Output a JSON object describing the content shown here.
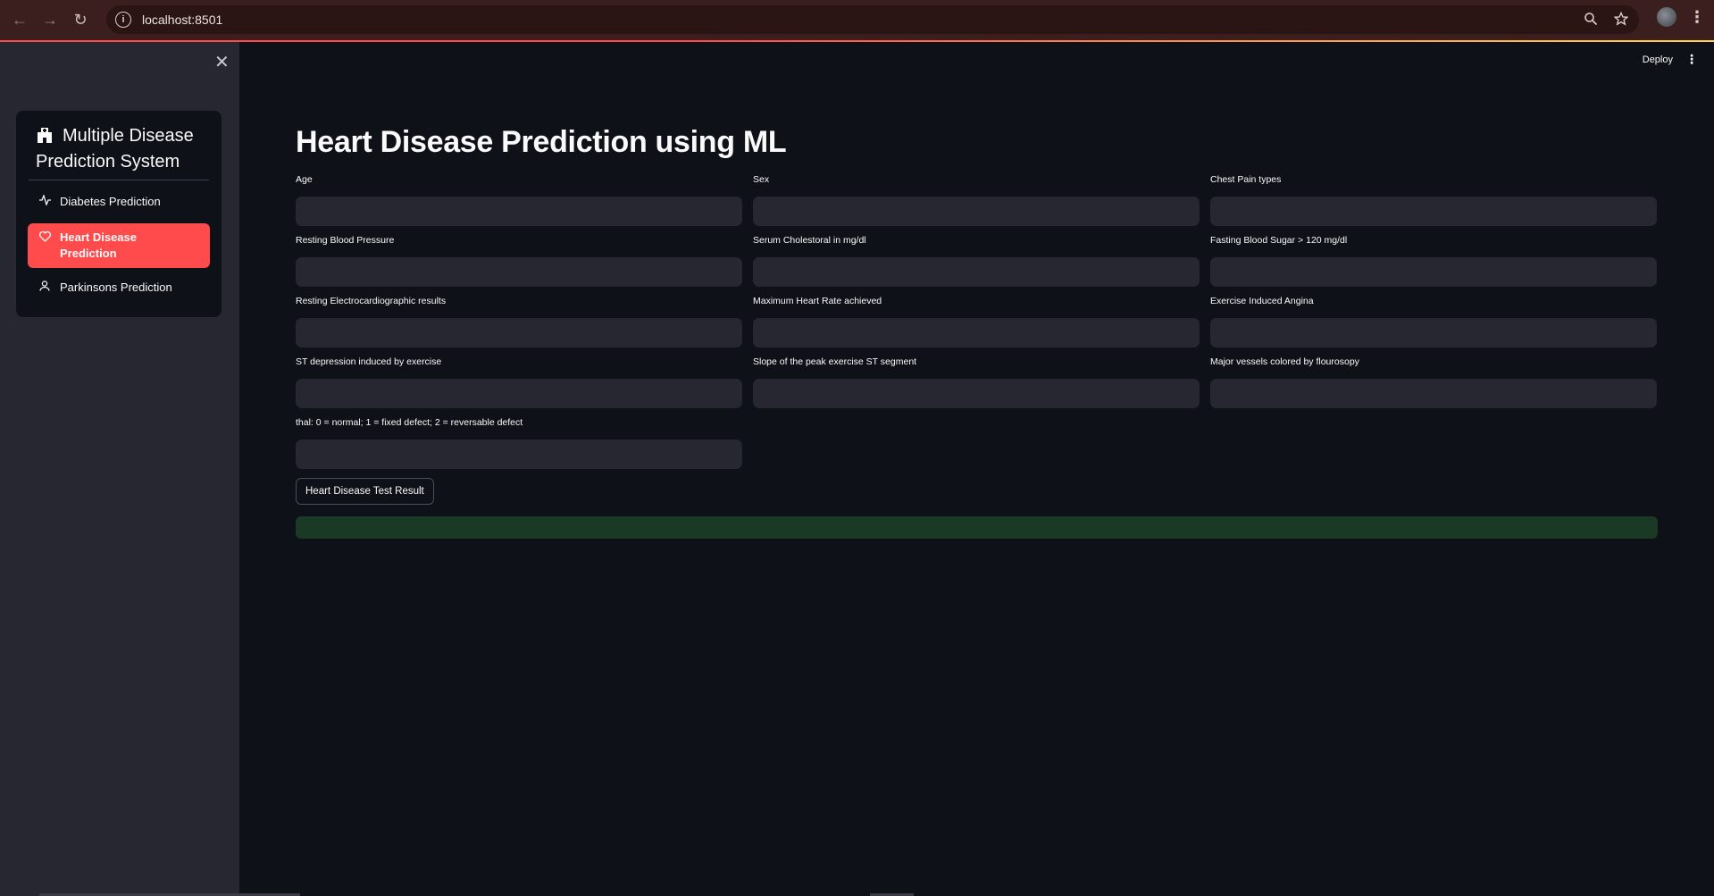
{
  "browser": {
    "url": "localhost:8501"
  },
  "app": {
    "deploy_label": "Deploy",
    "sidebar": {
      "menu_title": "Multiple Disease Prediction System",
      "items": [
        {
          "label": "Diabetes Prediction",
          "icon": "activity-icon",
          "selected": false
        },
        {
          "label": "Heart Disease Prediction",
          "icon": "heart-icon",
          "selected": true
        },
        {
          "label": "Parkinsons Prediction",
          "icon": "person-icon",
          "selected": false
        }
      ]
    },
    "main": {
      "title": "Heart Disease Prediction using ML",
      "fields": [
        {
          "label": "Age",
          "value": ""
        },
        {
          "label": "Sex",
          "value": ""
        },
        {
          "label": "Chest Pain types",
          "value": ""
        },
        {
          "label": "Resting Blood Pressure",
          "value": ""
        },
        {
          "label": "Serum Cholestoral in mg/dl",
          "value": ""
        },
        {
          "label": "Fasting Blood Sugar > 120 mg/dl",
          "value": ""
        },
        {
          "label": "Resting Electrocardiographic results",
          "value": ""
        },
        {
          "label": "Maximum Heart Rate achieved",
          "value": ""
        },
        {
          "label": "Exercise Induced Angina",
          "value": ""
        },
        {
          "label": "ST depression induced by exercise",
          "value": ""
        },
        {
          "label": "Slope of the peak exercise ST segment",
          "value": ""
        },
        {
          "label": "Major vessels colored by flourosopy",
          "value": ""
        },
        {
          "label": "thal: 0 = normal; 1 = fixed defect; 2 = reversable defect",
          "value": ""
        }
      ],
      "submit_label": "Heart Disease Test Result",
      "result_text": ""
    },
    "colors": {
      "accent": "#ff4b4b",
      "background": "#0e1117",
      "sidebar": "#262730",
      "result_bg": "#1b3a26"
    }
  }
}
